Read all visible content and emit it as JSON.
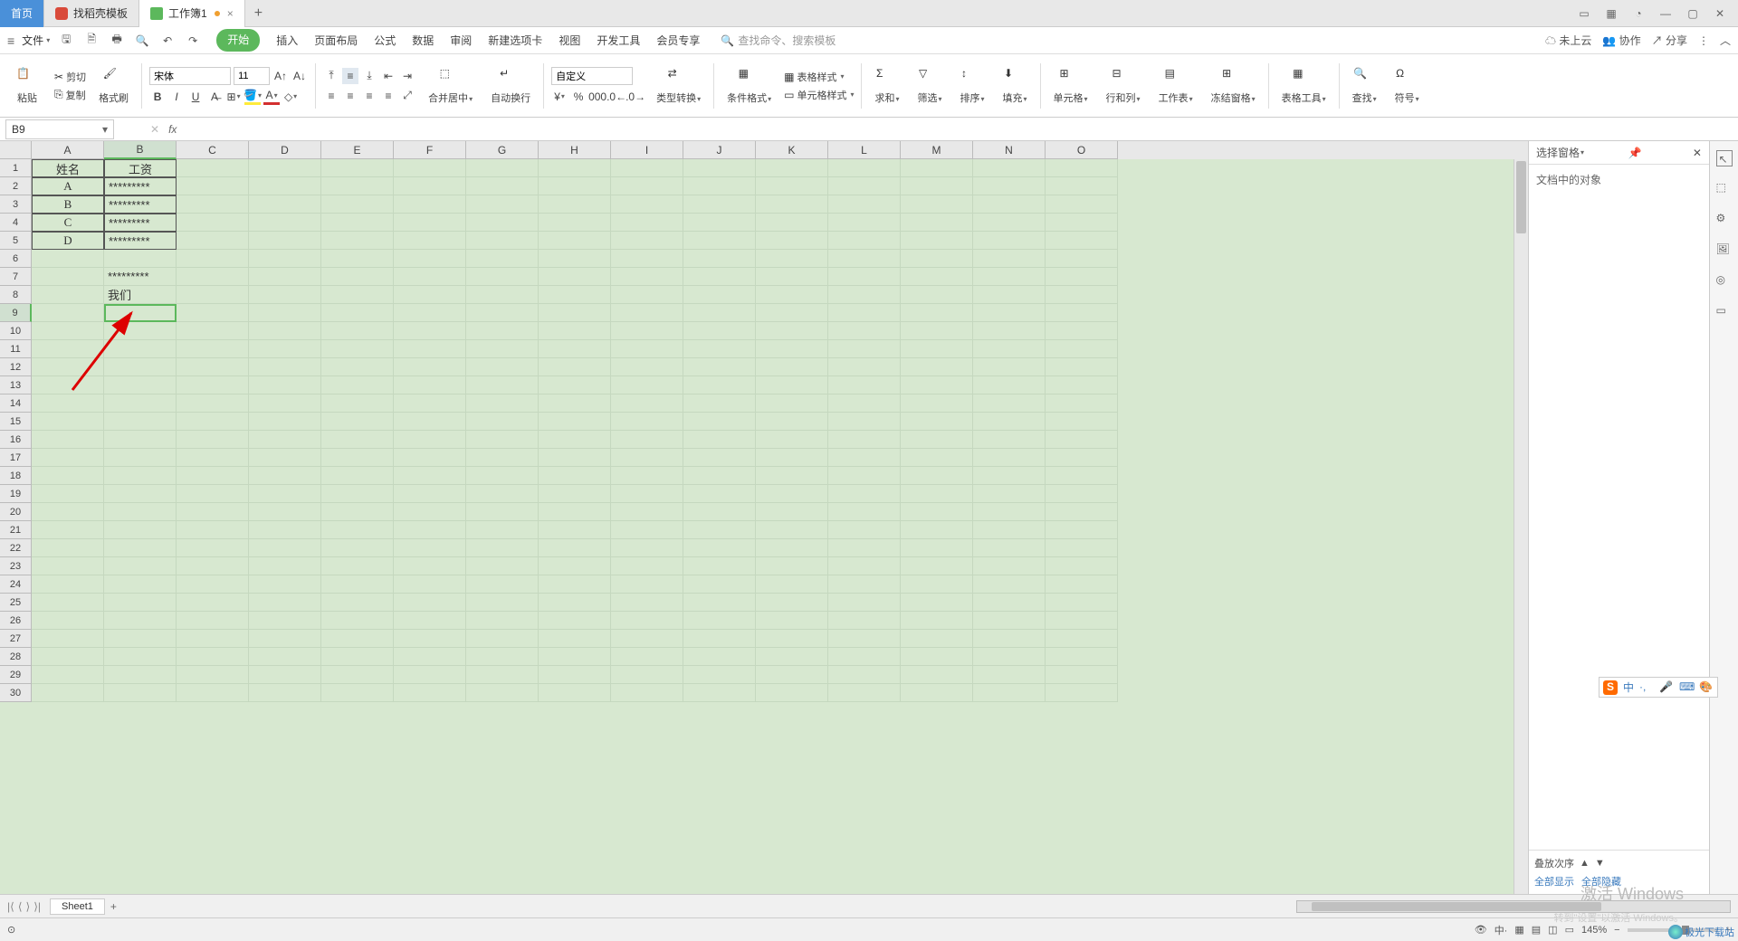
{
  "tabs": {
    "home": "首页",
    "template": "找稻壳模板",
    "workbook": "工作簿1"
  },
  "menubar": {
    "file": "文件",
    "search_placeholder": "查找命令、搜索模板"
  },
  "ribbon_tabs": [
    "开始",
    "插入",
    "页面布局",
    "公式",
    "数据",
    "审阅",
    "新建选项卡",
    "视图",
    "开发工具",
    "会员专享"
  ],
  "ribbon_right": {
    "cloud": "未上云",
    "collab": "协作",
    "share": "分享"
  },
  "ribbon": {
    "paste": "粘贴",
    "cut": "剪切",
    "copy": "复制",
    "format_painter": "格式刷",
    "font_name": "宋体",
    "font_size": "11",
    "merge": "合并居中",
    "wrap": "自动换行",
    "num_format": "自定义",
    "type_convert": "类型转换",
    "cond_format": "条件格式",
    "table_style": "表格样式",
    "cell_style": "单元格样式",
    "sum": "求和",
    "filter": "筛选",
    "sort": "排序",
    "fill": "填充",
    "cell": "单元格",
    "rowcol": "行和列",
    "sheet": "工作表",
    "freeze": "冻结窗格",
    "table_tools": "表格工具",
    "find": "查找",
    "symbol": "符号"
  },
  "name_box": "B9",
  "fx_label": "fx",
  "columns": [
    "A",
    "B",
    "C",
    "D",
    "E",
    "F",
    "G",
    "H",
    "I",
    "J",
    "K",
    "L",
    "M",
    "N",
    "O"
  ],
  "row_count": 30,
  "selected_col": 1,
  "selected_row": 9,
  "table": {
    "headers": [
      "姓名",
      "工资"
    ],
    "rows": [
      [
        "A",
        "*********"
      ],
      [
        "B",
        "*********"
      ],
      [
        "C",
        "*********"
      ],
      [
        "D",
        "*********"
      ]
    ],
    "extra": {
      "b7": "*********",
      "b8": "我们"
    }
  },
  "right_pane": {
    "title": "选择窗格",
    "subtitle": "文档中的对象",
    "stack_label": "叠放次序",
    "show_all": "全部显示",
    "hide_all": "全部隐藏"
  },
  "sheet": {
    "name": "Sheet1"
  },
  "status": {
    "zoom": "145%",
    "watermark": "激活 Windows",
    "watermark2": "转到\"设置\"以激活 Windows。",
    "site": "极光下载站"
  },
  "ime": {
    "lang": "中"
  }
}
